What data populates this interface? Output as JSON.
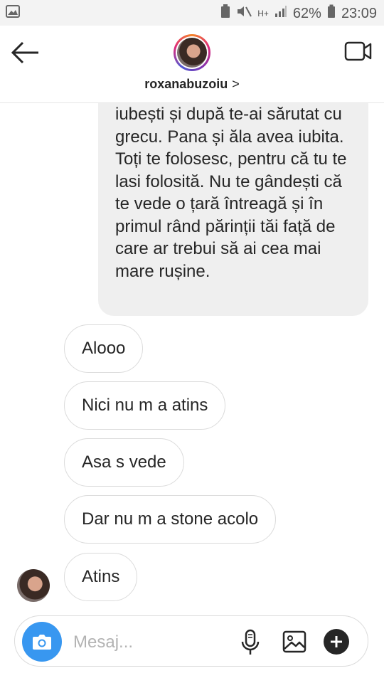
{
  "status_bar": {
    "battery_percent": "62%",
    "time": "23:09",
    "network": "H+"
  },
  "header": {
    "username": "roxanabuzoiu",
    "chevron": ">"
  },
  "messages": {
    "long_text": "iubești și după te-ai sărutat cu grecu. Pana și ăla avea iubita. Toți te folosesc, pentru că tu te lasi folosită. Nu te gândești că te vede o țară întreagă și în primul rând părinții tăi față de care ar trebui să ai cea mai mare rușine.",
    "items": [
      "Alooo",
      "Nici nu m a atins",
      "Asa s vede",
      "Dar nu m a stone acolo",
      "Atins"
    ]
  },
  "composer": {
    "placeholder": "Mesaj..."
  },
  "colors": {
    "accent": "#3897f0",
    "bubble_gray": "#efefef",
    "border": "#dbdbdb",
    "text": "#262626"
  }
}
